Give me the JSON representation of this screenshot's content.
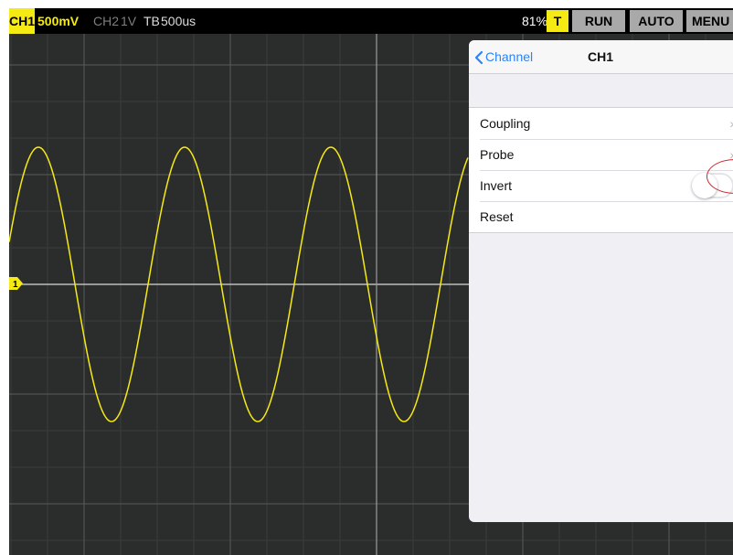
{
  "status_bar": {
    "ch1_tag": "CH1",
    "ch1_volts": "500mV",
    "ch2_label": "CH2",
    "ch2_volts": "1V",
    "timebase_label": "TB",
    "timebase_value": "500us",
    "battery": "81%"
  },
  "toolbar": {
    "trigger_label": "T",
    "run_label": "RUN",
    "auto_label": "AUTO",
    "menu_label": "MENU"
  },
  "channel_marker": "1",
  "panel": {
    "back_label": "Channel",
    "title": "CH1",
    "items": [
      {
        "label": "Coupling",
        "accessory": "chevron"
      },
      {
        "label": "Probe",
        "accessory": "chevron"
      },
      {
        "label": "Invert",
        "accessory": "toggle",
        "state": "off"
      },
      {
        "label": "Reset",
        "accessory": "none"
      }
    ]
  },
  "colors": {
    "ch1": "#f5ea14",
    "screen_bg": "#2b2d2d",
    "grid": "#5a5c5c",
    "accent": "#2a84f7",
    "highlight": "#d0262b"
  },
  "trace": {
    "shape": "sine",
    "cycles_visible": 3,
    "amplitude_divisions": 3.8,
    "samples": 200
  }
}
